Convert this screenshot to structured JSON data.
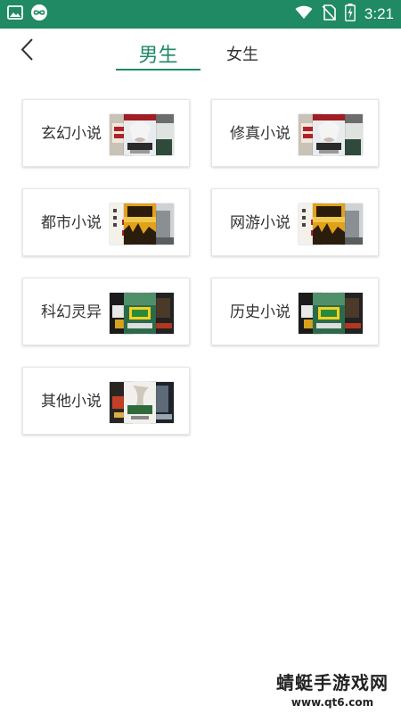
{
  "status_bar": {
    "time": "3:21",
    "icons": [
      "image-icon",
      "infinity-icon",
      "wifi-icon",
      "no-sim-icon",
      "battery-charging-icon"
    ]
  },
  "nav": {
    "back_icon": "chevron-left-icon",
    "tabs": [
      {
        "label": "男生",
        "active": true
      },
      {
        "label": "女生",
        "active": false
      }
    ]
  },
  "categories": [
    {
      "label": "玄幻小说",
      "cover_set": "fantasy"
    },
    {
      "label": "修真小说",
      "cover_set": "fantasy"
    },
    {
      "label": "都市小说",
      "cover_set": "urban"
    },
    {
      "label": "网游小说",
      "cover_set": "urban"
    },
    {
      "label": "科幻灵异",
      "cover_set": "scifi"
    },
    {
      "label": "历史小说",
      "cover_set": "scifi"
    },
    {
      "label": "其他小说",
      "cover_set": "other"
    }
  ],
  "colors": {
    "accent": "#1f8a64",
    "text": "#333333",
    "card_border": "#e6e6e6"
  },
  "watermark": {
    "title": "蜻蜓手游戏网",
    "url": "www.qt6.com"
  }
}
